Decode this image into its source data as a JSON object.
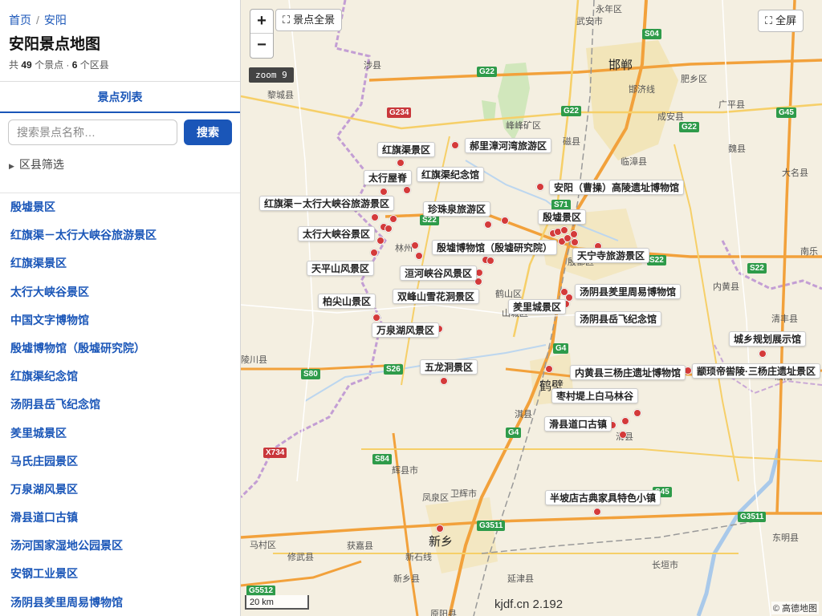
{
  "breadcrumb": {
    "home": "首页",
    "current": "安阳"
  },
  "page": {
    "title": "安阳景点地图",
    "stats_prefix": "共",
    "spot_count": "49",
    "spot_unit": "个景点 ·",
    "district_count": "6",
    "district_unit": "个区县"
  },
  "tab": {
    "label": "景点列表"
  },
  "search": {
    "placeholder": "搜索景点名称…",
    "button": "搜索"
  },
  "filter": {
    "label": "区县筛选"
  },
  "spots": [
    "殷墟景区",
    "红旗渠－太行大峡谷旅游景区",
    "红旗渠景区",
    "太行大峡谷景区",
    "中国文字博物馆",
    "殷墟博物馆（殷墟研究院）",
    "红旗渠纪念馆",
    "汤阴县岳飞纪念馆",
    "羑里城景区",
    "马氏庄园景区",
    "万泉湖风景区",
    "滑县道口古镇",
    "汤河国家湿地公园景区",
    "安钢工业景区",
    "汤阴县羑里周易博物馆"
  ],
  "map": {
    "zoom_in": "+",
    "zoom_out": "−",
    "overview_button": "景点全景",
    "fullscreen_button": "全屏",
    "zoom_level": "zoom 9",
    "scale": "20 km",
    "watermark": "kjdf.cn 2.192",
    "attribution": "© 高德地图",
    "labels": [
      "红旗渠景区",
      "郝里漳河湾旅游区",
      "太行屋脊",
      "红旗渠纪念馆",
      "安阳（曹操）高陵遗址博物馆",
      "红旗渠－太行大峡谷旅游景区",
      "珍珠泉旅游区",
      "殷墟景区",
      "太行大峡谷景区",
      "殷墟博物馆（殷墟研究院）",
      "天宁寺旅游景区",
      "天平山风景区",
      "洹河峡谷风景区",
      "汤阴县羑里周易博物馆",
      "柏尖山景区",
      "双峰山雪花洞景区",
      "羑里城景区",
      "汤阴县岳飞纪念馆",
      "万泉湖风景区",
      "城乡规划展示馆",
      "五龙洞景区",
      "内黄县三杨庄遗址博物馆",
      "颛顼帝喾陵·三杨庄遗址景区",
      "枣村堤上白马林谷",
      "滑县道口古镇",
      "半坡店古典家具特色小镇"
    ],
    "places": [
      "邯郸",
      "鹤壁",
      "新乡",
      "武安市",
      "涉县",
      "黎城县",
      "峰峰矿区",
      "磁县",
      "临漳县",
      "肥乡区",
      "成安县",
      "广平县",
      "魏县",
      "大名县",
      "邯济线",
      "林州",
      "殷都区",
      "鹤山区",
      "山城区",
      "内黄县",
      "清丰县",
      "南乐",
      "濮阳",
      "淇县",
      "滑县",
      "辉县市",
      "卫辉市",
      "凤泉区",
      "获嘉县",
      "修武县",
      "马村区",
      "新石线",
      "新乡县",
      "延津县",
      "长垣市",
      "东明县",
      "陵川县",
      "永年区",
      "原阳县"
    ],
    "roads": [
      "S04",
      "G22",
      "G234",
      "G22",
      "G22",
      "G45",
      "S71",
      "S22",
      "S22",
      "S22",
      "G4",
      "S80",
      "S26",
      "G4",
      "S84",
      "X734",
      "G3511",
      "G3511",
      "G5512",
      "S45"
    ],
    "colors": {
      "marker": "#d43a3a",
      "motorway": "#f2a13b",
      "trunk": "#f6cf68",
      "water": "#a9c9ea",
      "park": "#cde6b8",
      "accent": "#1a56b8"
    }
  }
}
